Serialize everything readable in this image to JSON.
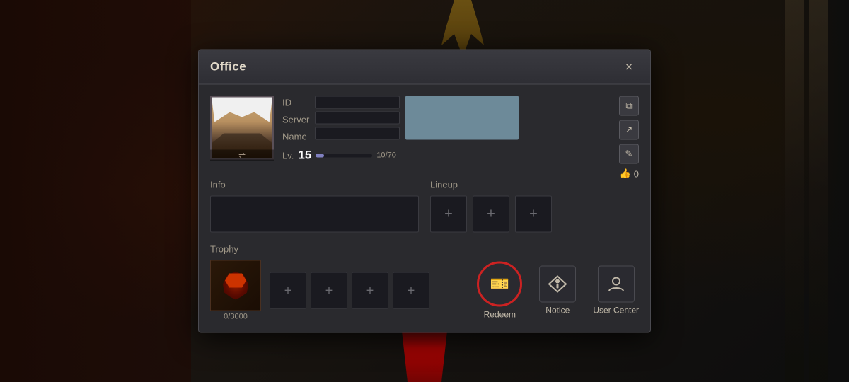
{
  "dialog": {
    "title": "Office",
    "close_label": "×"
  },
  "profile": {
    "id_label": "ID",
    "server_label": "Server",
    "name_label": "Name",
    "level_label": "Lv.",
    "level_value": "15",
    "xp_current": "10",
    "xp_max": "70",
    "like_count": "0"
  },
  "sections": {
    "info_label": "Info",
    "lineup_label": "Lineup",
    "lineup_slots": [
      "+",
      "+",
      "+"
    ]
  },
  "trophy": {
    "label": "Trophy",
    "current": "0",
    "max": "3000",
    "count_label": "0/3000",
    "add_slots": [
      "+",
      "+",
      "+",
      "+"
    ]
  },
  "actions": {
    "redeem_label": "Redeem",
    "notice_label": "Notice",
    "user_center_label": "User Center"
  },
  "icons": {
    "copy": "⧉",
    "share": "↗",
    "edit": "✎",
    "like": "👍",
    "ticket": "🎫",
    "notice": "🔔",
    "user": "👤"
  }
}
